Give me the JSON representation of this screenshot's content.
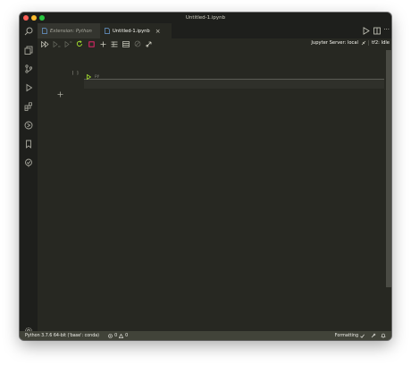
{
  "window": {
    "title": "Untitled-1.ipynb"
  },
  "tabs": [
    {
      "label": "Extension: Python",
      "active": false
    },
    {
      "label": "Untitled-1.ipynb",
      "active": true
    }
  ],
  "toolbar": {
    "jupyter_server": "Jupyter Server: local",
    "kernel": "tf2: Idle"
  },
  "cell": {
    "execution_count": "[ ]",
    "language": "py",
    "content": ""
  },
  "status": {
    "interpreter": "Python 3.7.6 64-bit ('base': conda)",
    "errors": "0",
    "warnings": "0",
    "formatting": "Formatting"
  },
  "colors": {
    "background": "#272822",
    "sidebar": "#1e1f1c",
    "statusbar": "#414339",
    "accent_green": "#a6e22e",
    "close_red": "#ff5f57",
    "minimize_yellow": "#febc2e",
    "maximize_green": "#28c840"
  }
}
